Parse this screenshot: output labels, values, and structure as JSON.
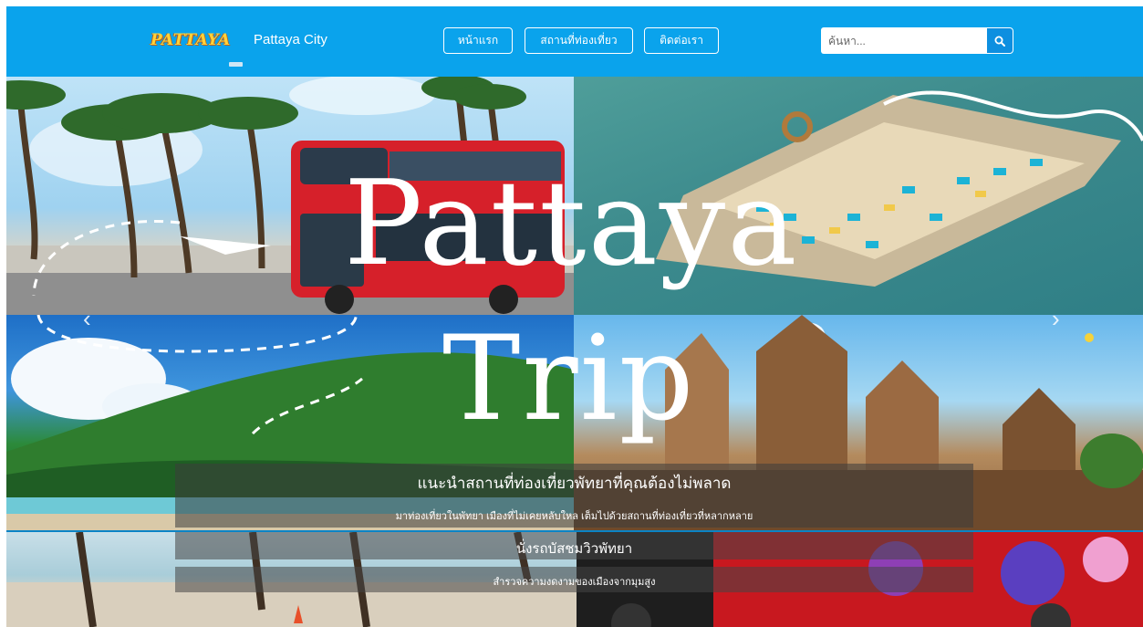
{
  "navbar": {
    "logo_text": "PATTAYA",
    "brand_name": "Pattaya City",
    "links": [
      {
        "label": "หน้าแรก"
      },
      {
        "label": "สถานที่ท่องเที่ยว"
      },
      {
        "label": "ติดต่อเรา"
      }
    ],
    "search": {
      "placeholder": "ค้นหา..."
    }
  },
  "hero": {
    "title_line1": "Pattaya",
    "title_line2": "Trip",
    "caption_title": "แนะนำสถานที่ท่องเที่ยวพัทยาที่คุณต้องไม่พลาด",
    "caption_text": "มาท่องเที่ยวในพัทยา เมืองที่ไม่เคยหลับใหล เต็มไปด้วยสถานที่ท่องเที่ยวที่หลากหลาย",
    "prev_icon": "chevron-left-icon",
    "next_icon": "chevron-right-icon"
  },
  "slide2": {
    "caption_title": "นั่งรถบัสชมวิวพัทยา",
    "caption_text": "สำรวจความงดงามของเมืองจากมุมสูง"
  },
  "colors": {
    "navbar": "#0aa3ec",
    "logo": "#ffd23a",
    "caption_overlay": "rgba(60,60,60,0.55)"
  }
}
